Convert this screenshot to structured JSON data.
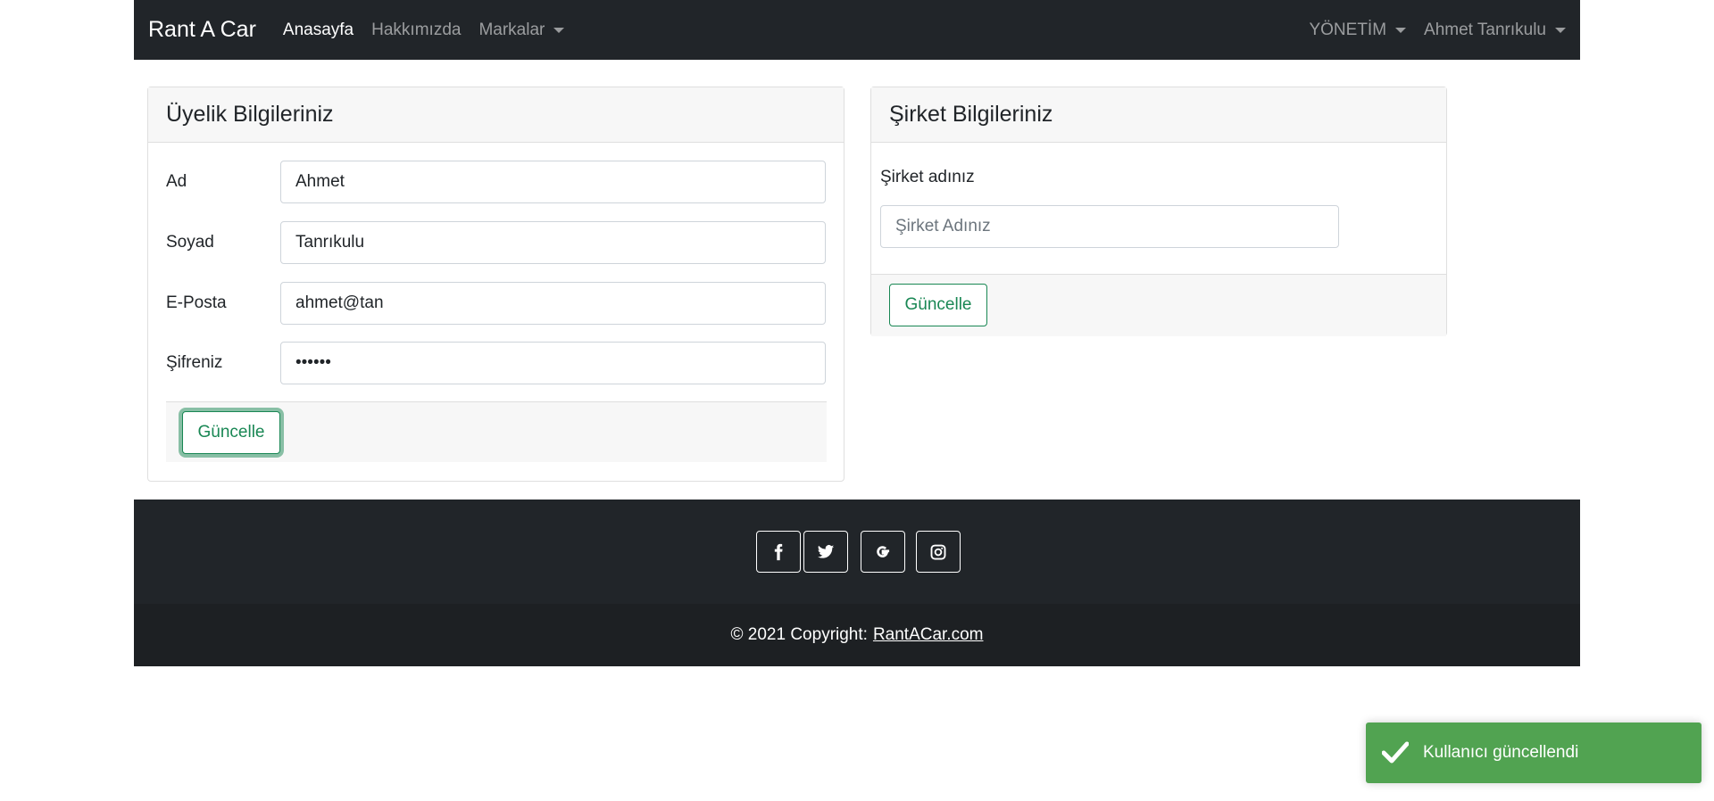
{
  "navbar": {
    "brand": "Rant A Car",
    "links": [
      {
        "label": "Anasayfa",
        "active": true
      },
      {
        "label": "Hakkımızda",
        "active": false
      },
      {
        "label": "Markalar",
        "active": false
      }
    ],
    "right": [
      {
        "label": "YÖNETİM"
      },
      {
        "label": "Ahmet Tanrıkulu"
      }
    ]
  },
  "user_card": {
    "title": "Üyelik Bilgileriniz",
    "fields": [
      {
        "label": "Ad",
        "value": "Ahmet"
      },
      {
        "label": "Soyad",
        "value": "Tanrıkulu"
      },
      {
        "label": "E-Posta",
        "value": "ahmet@tan"
      },
      {
        "label": "Şifreniz",
        "value": "••••••"
      }
    ],
    "button": "Güncelle"
  },
  "company_card": {
    "title": "Şirket Bilgileriniz",
    "label": "Şirket adınız",
    "placeholder": "Şirket Adınız",
    "button": "Güncelle"
  },
  "footer": {
    "social": [
      "facebook-icon",
      "twitter-icon",
      "google-icon",
      "instagram-icon"
    ],
    "copyright": "© 2021 Copyright:",
    "link": "RantACar.com"
  },
  "toast": {
    "message": "Kullanıcı güncellendi",
    "color": "#51a351"
  }
}
